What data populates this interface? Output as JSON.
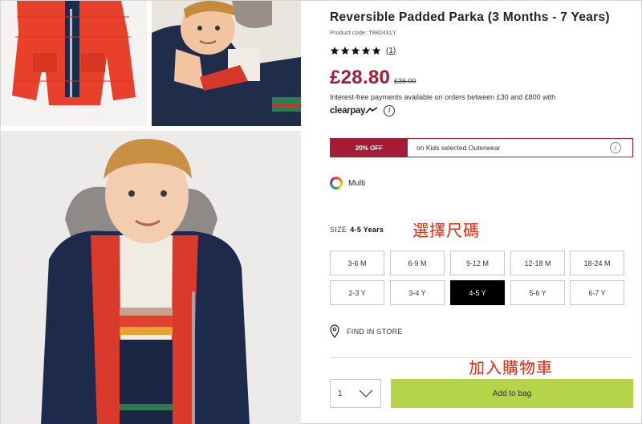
{
  "product": {
    "title": "Reversible Padded Parka (3 Months - 7 Years)",
    "code": "Product code: T882431Y",
    "rating_stars": 5,
    "review_count": "(1)",
    "price": "£28.80",
    "was_price": "£36.00",
    "interest_text": "Interest-free payments available on orders between £30 and £800 with",
    "clearpay_label": "clearpay",
    "info_glyph": "i"
  },
  "promo": {
    "tag": "20% OFF",
    "text": "on Kids selected Outerwear",
    "info_glyph": "i"
  },
  "colour": {
    "name": "Multi"
  },
  "size": {
    "label": "SIZE",
    "selected": "4-5 Years",
    "options": [
      "3-6 M",
      "6-9 M",
      "9-12 M",
      "12-18 M",
      "18-24 M",
      "2-3 Y",
      "3-4 Y",
      "4-5 Y",
      "5-6 Y",
      "6-7 Y"
    ],
    "selected_index": 7
  },
  "annotations": {
    "select_size": "選擇尺碼",
    "add_to_cart": "加入購物車"
  },
  "store": {
    "label": "FIND IN STORE"
  },
  "purchase": {
    "quantity": "1",
    "add_label": "Add to bag"
  },
  "colors": {
    "accent": "#a41d35",
    "add_button": "#b5d449",
    "annotation": "#e8290b"
  }
}
